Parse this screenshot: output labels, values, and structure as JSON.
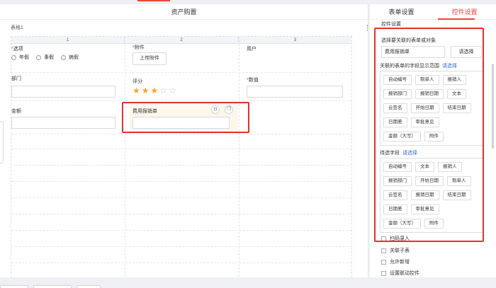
{
  "canvas": {
    "title": "资产购置",
    "table_label": "表格1",
    "more_icon": "vertical-dots-icon",
    "columns": [
      "1",
      "2",
      "3"
    ],
    "fields": {
      "options_label": "选项",
      "options": [
        "年假",
        "事假",
        "病假"
      ],
      "attachment_label": "附件",
      "upload_button": "上传附件",
      "user_label": "用户",
      "department_label": "部门",
      "rating_label": "评分",
      "rating_value": 3,
      "rating_max": 5,
      "number_label": "数值",
      "amount_label": "金额",
      "selected_field_label": "费用报销单",
      "delete_icon": "trash-icon",
      "copy_icon": "copy-icon"
    }
  },
  "panel": {
    "tabs": [
      "表单设置",
      "控件设置"
    ],
    "active_tab": 1,
    "section_title": "控件设置",
    "object_label": "选择要关联的表单或对象",
    "object_value": "费用报销单",
    "object_button": "请选择",
    "range_label": "关联的表单的字段显示范围",
    "range_link": "请选择",
    "range_fields": [
      "自动编号",
      "制单人",
      "报销人",
      "报销部门",
      "报销日期",
      "文本",
      "云签名",
      "开始日期",
      "结束日期",
      "日期差",
      "审批意见",
      "金额（大写）",
      "附件"
    ],
    "candidate_label": "待选字段",
    "candidate_link": "请选择",
    "candidate_fields": [
      "自动编号",
      "文本",
      "报销人",
      "报销部门",
      "开始日期",
      "制单人",
      "云签名",
      "报销日期",
      "结束日期",
      "日期差",
      "审批意见",
      "金额（大写）",
      "附件"
    ],
    "checkboxes": [
      "扫码录入",
      "关联子表",
      "允许新增",
      "设置联动控件"
    ]
  },
  "colors": {
    "accent": "#e8463a",
    "highlight": "#e03030",
    "link": "#2f6fd1",
    "star": "#f5a623"
  }
}
